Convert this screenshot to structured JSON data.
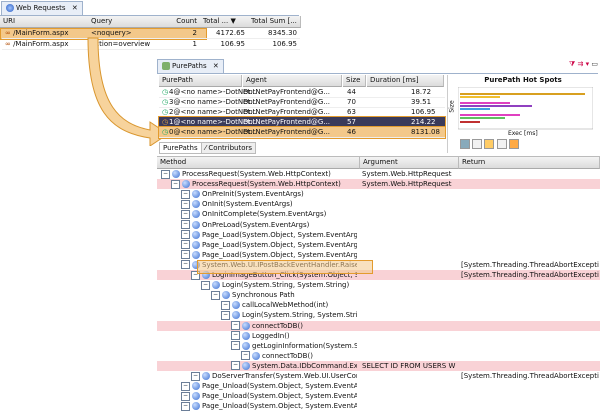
{
  "web_requests": {
    "tab_label": "Web Requests",
    "columns": [
      "URI",
      "Query",
      "Count",
      "Total ...",
      "Total Sum [..."
    ],
    "rows": [
      {
        "uri": "/MainForm.aspx",
        "query": "<noquery>",
        "count": "2",
        "total": "4172.65",
        "sum": "8345.30"
      },
      {
        "uri": "/MainForm.aspx",
        "query": "action=overview",
        "count": "1",
        "total": "106.95",
        "sum": "106.95"
      }
    ]
  },
  "purepaths": {
    "tab_label": "PurePaths",
    "subtab_contributors": "Contributors",
    "subtab_purepaths": "PurePaths",
    "columns": [
      "PurePath",
      "Agent",
      "Size",
      "Duration [ms]"
    ],
    "rows": [
      {
        "path": "4@<no name>-DotNet...",
        "agent": "DotNetPayFrontend@G...",
        "size": "44",
        "duration": "18.72"
      },
      {
        "path": "3@<no name>-DotNet...",
        "agent": "DotNetPayFrontend@G...",
        "size": "70",
        "duration": "39.51"
      },
      {
        "path": "2@<no name>-DotNet...",
        "agent": "DotNetPayFrontend@G...",
        "size": "63",
        "duration": "106.95"
      },
      {
        "path": "1@<no name>-DotNet...",
        "agent": "DotNetPayFrontend@G...",
        "size": "57",
        "duration": "214.22"
      },
      {
        "path": "0@<no name>-DotNet...",
        "agent": "DotNetPayFrontend@G...",
        "size": "46",
        "duration": "8131.08"
      }
    ]
  },
  "hotspots": {
    "title": "PurePath Hot Spots",
    "ylabel": "Size",
    "xlabel": "Exec [ms]"
  },
  "tree": {
    "columns": [
      "Method",
      "Argument",
      "Return"
    ],
    "rows": [
      {
        "indent": 0,
        "label": "ProcessRequest(System.Web.HttpContext)",
        "arg": "System.Web.HttpRequest",
        "ret": "",
        "pink": false
      },
      {
        "indent": 1,
        "label": "ProcessRequest(System.Web.HttpContext)",
        "arg": "System.Web.HttpRequest",
        "ret": "",
        "pink": true
      },
      {
        "indent": 2,
        "label": "OnPreInit(System.EventArgs)",
        "arg": "",
        "ret": "",
        "pink": false
      },
      {
        "indent": 2,
        "label": "OnInit(System.EventArgs)",
        "arg": "",
        "ret": "",
        "pink": false
      },
      {
        "indent": 2,
        "label": "OnInitComplete(System.EventArgs)",
        "arg": "",
        "ret": "",
        "pink": false
      },
      {
        "indent": 2,
        "label": "OnPreLoad(System.EventArgs)",
        "arg": "",
        "ret": "",
        "pink": false
      },
      {
        "indent": 2,
        "label": "Page_Load(System.Object, System.EventArgs)",
        "arg": "",
        "ret": "",
        "pink": false
      },
      {
        "indent": 2,
        "label": "Page_Load(System.Object, System.EventArgs)",
        "arg": "",
        "ret": "",
        "pink": false
      },
      {
        "indent": 2,
        "label": "Page_Load(System.Object, System.EventArgs)",
        "arg": "",
        "ret": "",
        "pink": false
      },
      {
        "indent": 2,
        "label": "System.Web.UI.IPostBackEventHandler.RaisePostBackEve...",
        "arg": "",
        "ret": "[System.Threading.ThreadAbortException: Threa",
        "pink": false
      },
      {
        "indent": 3,
        "label": "LoginImageButton_Click(System.Object, System.Web.I",
        "arg": "",
        "ret": "[System.Threading.ThreadAbortException: Threa",
        "pink": true
      },
      {
        "indent": 4,
        "label": "Login(System.String, System.String)",
        "arg": "",
        "ret": "",
        "pink": false
      },
      {
        "indent": 5,
        "label": "Synchronous Path",
        "arg": "",
        "ret": "",
        "pink": false
      },
      {
        "indent": 6,
        "label": "callLocalWebMethod(int)",
        "arg": "",
        "ret": "",
        "pink": false
      },
      {
        "indent": 6,
        "label": "Login(System.String, System.String)",
        "arg": "",
        "ret": "",
        "pink": false
      },
      {
        "indent": 7,
        "label": "connectToDB()",
        "arg": "",
        "ret": "",
        "pink": true
      },
      {
        "indent": 7,
        "label": "LoggedIn()",
        "arg": "",
        "ret": "",
        "pink": false
      },
      {
        "indent": 7,
        "label": "getLoginInformation(System.String, Syste",
        "arg": "",
        "ret": "",
        "pink": false
      },
      {
        "indent": 8,
        "label": "connectToDB()",
        "arg": "",
        "ret": "",
        "pink": false
      },
      {
        "indent": 7,
        "label": "System.Data.IDbCommand.ExecuteReade",
        "arg": "SELECT ID FROM USERS WHE...",
        "ret": "",
        "pink": true
      },
      {
        "indent": 3,
        "label": "DoServerTransfer(System.Web.UI.UserControl, Sys",
        "arg": "",
        "ret": "[System.Threading.ThreadAbortException: Threa",
        "pink": false
      },
      {
        "indent": 2,
        "label": "Page_Unload(System.Object, System.EventArgs)",
        "arg": "",
        "ret": "",
        "pink": false
      },
      {
        "indent": 2,
        "label": "Page_Unload(System.Object, System.EventArgs)",
        "arg": "",
        "ret": "",
        "pink": false
      },
      {
        "indent": 2,
        "label": "Page_Unload(System.Object, System.EventArgs)",
        "arg": "",
        "ret": "",
        "pink": false
      }
    ]
  },
  "colors": {
    "highlight_orange": "#f3c88a",
    "callout_border": "#e39b2e",
    "selected_dark": "#3a3a5a",
    "pink_row": "#f9d2d6"
  }
}
